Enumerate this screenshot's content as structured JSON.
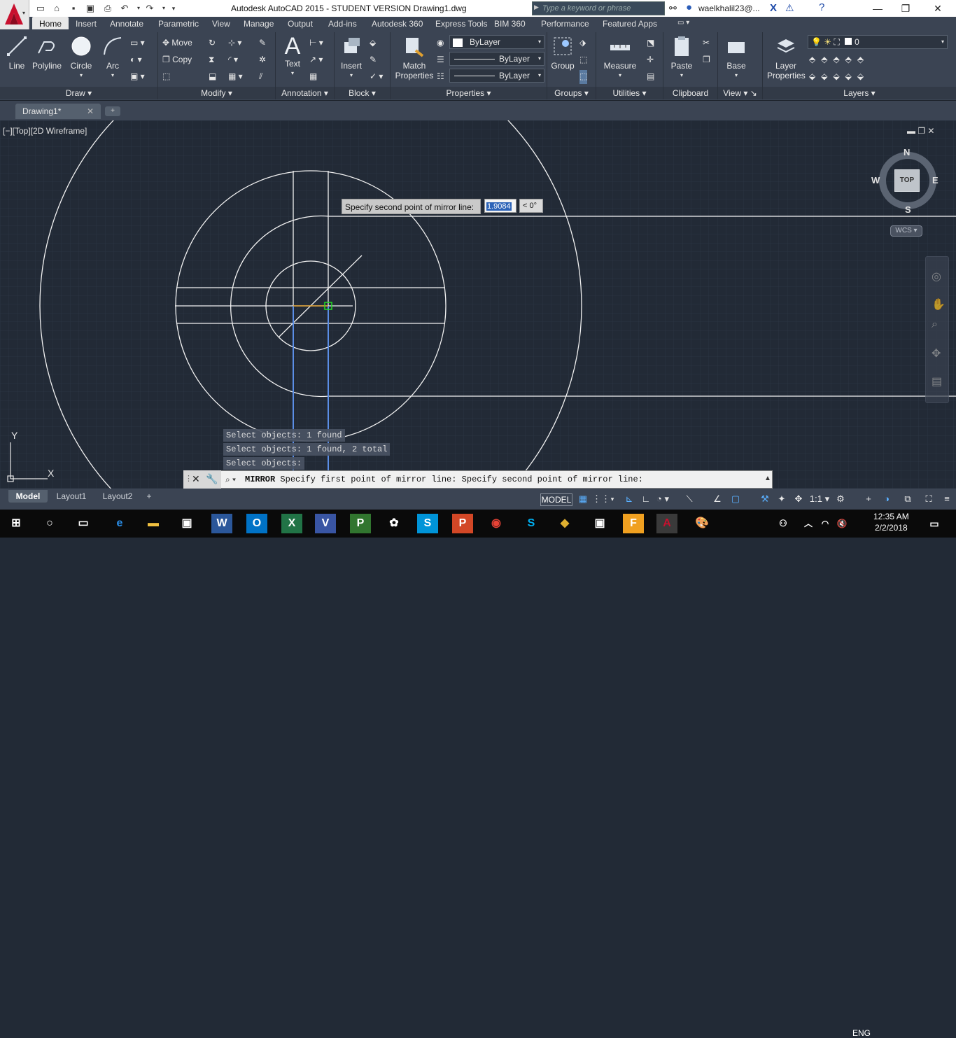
{
  "app": {
    "title": "Autodesk AutoCAD 2015 - STUDENT VERSION    Drawing1.dwg",
    "search_placeholder": "Type a keyword or phrase",
    "user": "waelkhalil23@...",
    "accent": "#c8102e"
  },
  "ribbon_tabs": [
    "Home",
    "Insert",
    "Annotate",
    "Parametric",
    "View",
    "Manage",
    "Output",
    "Add-ins",
    "Autodesk 360",
    "Express Tools",
    "BIM 360",
    "Performance",
    "Featured Apps"
  ],
  "ribbon": {
    "draw": {
      "label": "Draw",
      "line": "Line",
      "polyline": "Polyline",
      "circle": "Circle",
      "arc": "Arc"
    },
    "modify": {
      "label": "Modify",
      "move": "Move",
      "copy": "Copy"
    },
    "annotation": {
      "label": "Annotation",
      "text": "Text"
    },
    "block": {
      "label": "Block",
      "insert": "Insert"
    },
    "properties": {
      "label": "Properties",
      "match": "Match Properties",
      "color": "ByLayer",
      "linetype": "ByLayer",
      "lineweight": "ByLayer"
    },
    "groups": {
      "label": "Groups",
      "group": "Group"
    },
    "utilities": {
      "label": "Utilities",
      "measure": "Measure"
    },
    "clipboard": {
      "label": "Clipboard",
      "paste": "Paste"
    },
    "view": {
      "label": "View",
      "base": "Base"
    },
    "layers": {
      "label": "Layers",
      "layer_props": "Layer Properties",
      "current_layer": "0"
    }
  },
  "document_tab": "Drawing1*",
  "viewport": {
    "label": "[−][Top][2D Wireframe]",
    "viewcube": {
      "n": "N",
      "s": "S",
      "e": "E",
      "w": "W",
      "face": "TOP",
      "wcs": "WCS"
    },
    "ucs": {
      "x": "X",
      "y": "Y"
    }
  },
  "dynamic_input": {
    "prompt": "Specify second point of mirror line:",
    "length": "1.9084",
    "angle": "< 0°"
  },
  "command_history": [
    "Select objects: 1 found",
    "Select objects: 1 found, 2 total",
    "Select objects:"
  ],
  "command_line": {
    "command": "MIRROR",
    "text": " Specify first point of mirror line: Specify second point of mirror line:"
  },
  "layout_tabs": [
    "Model",
    "Layout1",
    "Layout2"
  ],
  "status": {
    "model": "MODEL",
    "scale": "1:1"
  },
  "taskbar": {
    "time": "12:35 AM",
    "date": "2/2/2018",
    "lang": "ENG"
  }
}
